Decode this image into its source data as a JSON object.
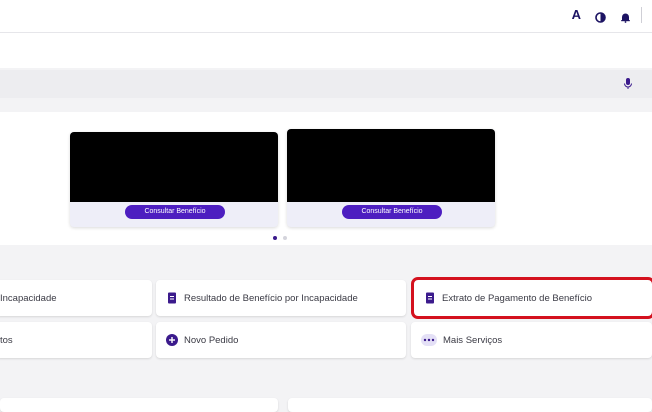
{
  "header": {
    "accessibility_label": "A",
    "contrast_icon": "contrast-icon",
    "notification_icon": "bell-icon"
  },
  "search": {
    "mic_icon": "microphone-icon"
  },
  "carousel": {
    "cards": [
      {
        "button_label": "Consultar Benefício"
      },
      {
        "button_label": "Consultar Benefício"
      }
    ],
    "active_page": 1,
    "pages": 2
  },
  "services": [
    {
      "label": "Incapacidade",
      "icon": ""
    },
    {
      "label": "Resultado de Benefício por Incapacidade",
      "icon": "document-icon"
    },
    {
      "label": "Extrato de Pagamento de Benefício",
      "icon": "document-icon"
    },
    {
      "label": "tos",
      "icon": ""
    },
    {
      "label": "Novo Pedido",
      "icon": "plus-circle-icon"
    },
    {
      "label": "Mais Serviços",
      "icon": "more-icon"
    }
  ],
  "colors": {
    "brand": "#1d1463",
    "button": "#4d1ec0",
    "highlight": "#d4111e"
  }
}
